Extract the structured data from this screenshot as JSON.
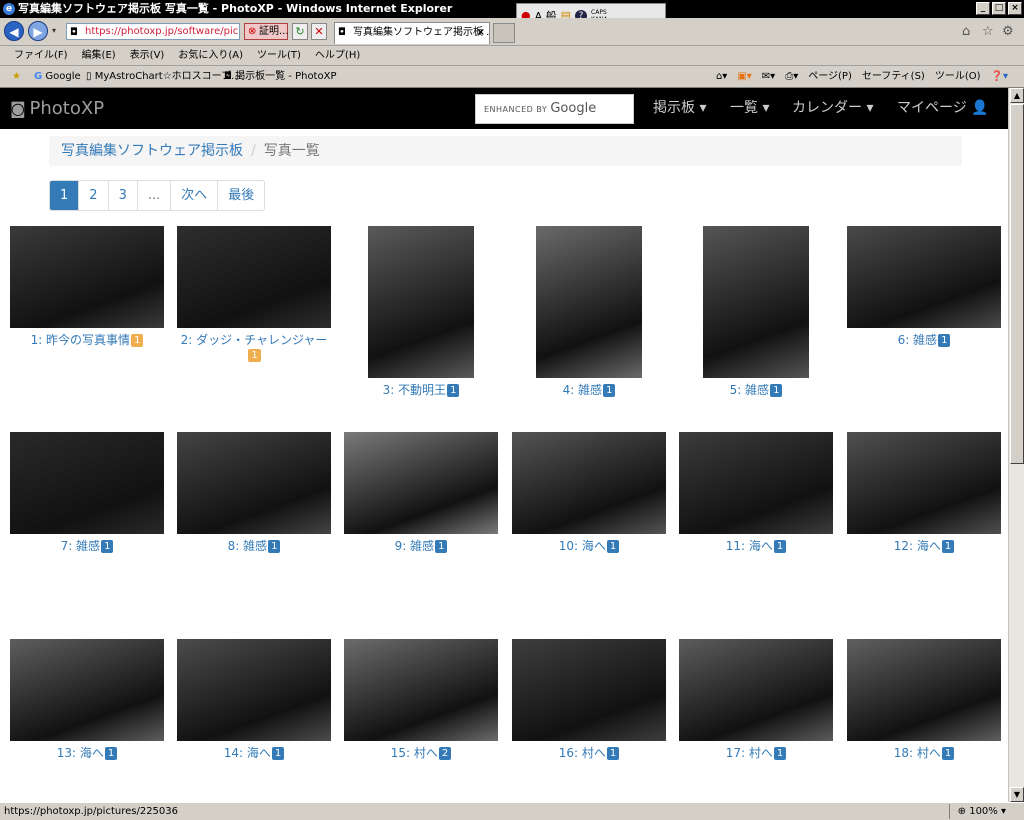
{
  "window": {
    "title": "写真編集ソフトウェア掲示板 写真一覧 - PhotoXP - Windows Internet Explorer",
    "ime_label": "A 般",
    "caps": "CAPS",
    "kana": "KANA"
  },
  "address": {
    "url": "https://photoxp.jp/software/pic",
    "cert": "証明...",
    "tab_title": "写真編集ソフトウェア掲示板 ..."
  },
  "menu": [
    "ファイル(F)",
    "編集(E)",
    "表示(V)",
    "お気に入り(A)",
    "ツール(T)",
    "ヘルプ(H)"
  ],
  "favorites": {
    "items": [
      "Google",
      "MyAstroChart☆ホロスコープ...",
      "掲示板一覧 - PhotoXP"
    ],
    "commands": [
      "ページ(P)",
      "セーフティ(S)",
      "ツール(O)"
    ]
  },
  "site": {
    "brand": "PhotoXP",
    "search_prefix": "ENHANCED BY",
    "search_brand": "Google",
    "nav": [
      "掲示板 ▾",
      "一覧 ▾",
      "カレンダー ▾",
      "マイページ 👤"
    ]
  },
  "breadcrumb": {
    "parent": "写真編集ソフトウェア掲示板",
    "sep": "/",
    "current": "写真一覧"
  },
  "pagination": [
    "1",
    "2",
    "3",
    "...",
    "次へ",
    "最後"
  ],
  "photos": [
    {
      "caption": "1: 昨今の写真事情",
      "count": "1",
      "badge_color": "#f0ad4e"
    },
    {
      "caption": "2: ダッジ・チャレンジャー",
      "count": "1",
      "badge_color": "#f0ad4e"
    },
    {
      "caption": "3: 不動明王",
      "count": "1",
      "badge_color": "#337ab7"
    },
    {
      "caption": "4: 雑感",
      "count": "1",
      "badge_color": "#337ab7"
    },
    {
      "caption": "5: 雑感",
      "count": "1",
      "badge_color": "#337ab7"
    },
    {
      "caption": "6: 雑感",
      "count": "1",
      "badge_color": "#337ab7"
    },
    {
      "caption": "7: 雑感",
      "count": "1",
      "badge_color": "#337ab7"
    },
    {
      "caption": "8: 雑感",
      "count": "1",
      "badge_color": "#337ab7"
    },
    {
      "caption": "9: 雑感",
      "count": "1",
      "badge_color": "#337ab7"
    },
    {
      "caption": "10: 海へ",
      "count": "1",
      "badge_color": "#337ab7"
    },
    {
      "caption": "11: 海へ",
      "count": "1",
      "badge_color": "#337ab7"
    },
    {
      "caption": "12: 海へ",
      "count": "1",
      "badge_color": "#337ab7"
    },
    {
      "caption": "13: 海へ",
      "count": "1",
      "badge_color": "#337ab7"
    },
    {
      "caption": "14: 海へ",
      "count": "1",
      "badge_color": "#337ab7"
    },
    {
      "caption": "15: 村へ",
      "count": "2",
      "badge_color": "#337ab7"
    },
    {
      "caption": "16: 村へ",
      "count": "1",
      "badge_color": "#337ab7"
    },
    {
      "caption": "17: 村へ",
      "count": "1",
      "badge_color": "#337ab7"
    },
    {
      "caption": "18: 村へ",
      "count": "1",
      "badge_color": "#337ab7"
    }
  ],
  "status": {
    "url": "https://photoxp.jp/pictures/225036",
    "zoom": "100%"
  }
}
